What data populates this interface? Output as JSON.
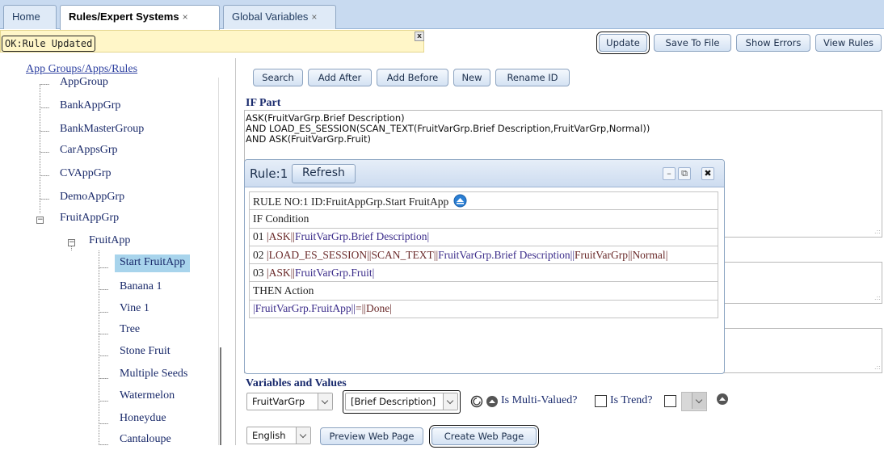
{
  "tabs": [
    {
      "label": "Home",
      "closable": false
    },
    {
      "label": "Rules/Expert Systems",
      "closable": true
    },
    {
      "label": "Global Variables",
      "closable": true
    }
  ],
  "tab_close_glyph": "×",
  "status": {
    "message": "OK:Rule Updated",
    "close_glyph": "x"
  },
  "toolbar": {
    "update": "Update",
    "save_to_file": "Save To File",
    "show_errors": "Show Errors",
    "view_rules": "View Rules"
  },
  "tree": {
    "title": "App Groups/Apps/Rules",
    "nodes": [
      "AppGroup",
      "BankAppGrp",
      "BankMasterGroup",
      "CarAppsGrp",
      "CVAppGrp",
      "DemoAppGrp",
      "FruitAppGrp",
      "FruitApp",
      "Start FruitApp",
      "Banana 1",
      "Vine 1",
      "Tree",
      "Stone Fruit",
      "Multiple Seeds",
      "Watermelon",
      "Honeydue",
      "Cantaloupe"
    ],
    "selected": "Start FruitApp"
  },
  "rule_buttons": {
    "search": "Search",
    "add_after": "Add After",
    "add_before": "Add Before",
    "new": "New",
    "rename_id": "Rename ID"
  },
  "if_part": {
    "label": "IF Part",
    "lines": [
      "ASK(FruitVarGrp.Brief Description)",
      "AND LOAD_ES_SESSION(SCAN_TEXT(FruitVarGrp.Brief Description,FruitVarGrp,Normal))",
      "AND ASK(FruitVarGrp.Fruit)"
    ]
  },
  "rule_popup": {
    "title": "Rule:1",
    "refresh": "Refresh",
    "rows": {
      "header": "RULE NO:1 ID:FruitAppGrp.Start FruitApp",
      "if_condition": "IF Condition",
      "cond_01_num": "01",
      "cond_01_a": "ASK",
      "cond_01_b": "FruitVarGrp.Brief Description",
      "cond_02_num": "02",
      "cond_02_a": "LOAD_ES_SESSION",
      "cond_02_b": "SCAN_TEXT",
      "cond_02_c": "FruitVarGrp.Brief Description",
      "cond_02_d": "FruitVarGrp",
      "cond_02_e": "Normal",
      "cond_03_num": "03",
      "cond_03_a": "ASK",
      "cond_03_b": "FruitVarGrp.Fruit",
      "then_action": "THEN Action",
      "action_a": "FruitVarGrp.FruitApp",
      "action_op": "=",
      "action_b": "Done"
    },
    "win_controls": {
      "minimize": "–",
      "popout": "⧉",
      "close": "✖"
    }
  },
  "variables": {
    "label": "Variables and Values",
    "group_select": "FruitVarGrp",
    "var_select": "[Brief Description]",
    "is_multi_valued": "Is Multi-Valued?",
    "is_trend": "Is Trend?"
  },
  "bottom": {
    "language": "English",
    "preview": "Preview Web Page",
    "create": "Create Web Page"
  },
  "colors": {
    "tab_bar": "#c8daf0",
    "status_bg": "#fff6c8",
    "selected_node": "#a8d4ec",
    "link": "#2c3fa0"
  },
  "icons": [
    "collapse-up-icon",
    "reset-circle-icon",
    "up-arrow-circle-icon",
    "minimize-icon",
    "popout-icon",
    "close-icon"
  ]
}
